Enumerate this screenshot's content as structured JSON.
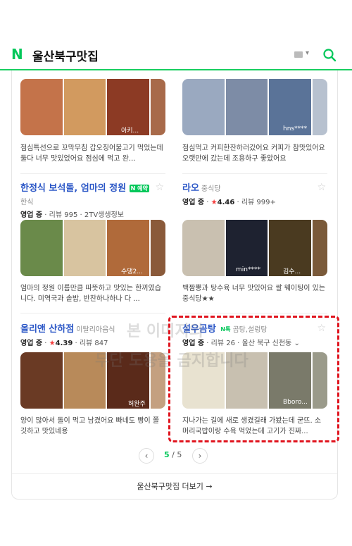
{
  "header": {
    "logo": "N",
    "query": "울산북구맛집"
  },
  "items": [
    {
      "review": "점심특선으로 꼬막무침 갑오징어불고기 먹었는데 둘다 너무 맛있었어요 점심에 먹고 완...",
      "review_bold": "꼬막무침",
      "thumb_user": "아키...",
      "colors": [
        "#c4734a",
        "#d29a5f",
        "#8c3a24",
        "#a86a4a"
      ]
    },
    {
      "review": "점심먹고 커피한잔하러갔어요 커피가 참맛있어요 오랫만에 갔는데 조용하구 좋았어요",
      "review_bold": "커피",
      "thumb_user": "hns****",
      "colors": [
        "#9aa9c0",
        "#7d8ca6",
        "#5a7398",
        "#b7c1cf"
      ]
    },
    {
      "title": "한정식 보석돌, 엄마의 정원",
      "badge": "N 예약",
      "sub": "한식",
      "status": "영업 중",
      "reviews": "리뷰 995",
      "tv": "TV",
      "tv_text": "2TV생생정보",
      "review": "엄마의 정원 이름만큼 따뜻하고 맛있는 한끼였습니다. 미역국과 솥밥, 반찬하나하나 다 ...",
      "review_bold": "미역국과 솥밥",
      "thumb_user": "수댕2...",
      "colors": [
        "#6a8a4a",
        "#d8c4a0",
        "#b06a3a",
        "#8a5a3a"
      ]
    },
    {
      "title": "라오",
      "cat": "중식당",
      "status": "영업 중",
      "rating": "4.46",
      "reviews": "리뷰 999+",
      "review": "백짬뽕과 탕수육 너무 맛있어요 쌀 웨이팅이 있는 중식당★★",
      "review_bold": "",
      "thumb_user": "min****",
      "thumb_user2": "김수...",
      "colors": [
        "#c9c0b0",
        "#1e2230",
        "#4a3a20",
        "#7a5a3a"
      ]
    },
    {
      "title": "올리앤 산하점",
      "cat": "이탈리아음식",
      "status": "영업 중",
      "rating": "4.39",
      "reviews": "리뷰 847",
      "review": "양이 많아서 돌이 먹고 남겼어요 빠네도 빵이 쫄깃하고 맛있네용",
      "review_bold": "빠네",
      "thumb_user": "허완주",
      "colors": [
        "#6a3a24",
        "#b88a5a",
        "#5a2a1a",
        "#c4a080"
      ]
    },
    {
      "title": "설우곰탕",
      "badge": "N톡",
      "cat": "곰탕,설렁탕",
      "status": "영업 중",
      "reviews": "리뷰 26",
      "location": "울산 북구 신천동",
      "review": "지나가는 길에 새로 생겼길래 가봤는데 굳뜨. 소머리국밥이랑 수육 먹었는데 고기가 진짜...",
      "review_bold": "고기",
      "thumb_user": "Bboro...",
      "colors": [
        "#e8e2d0",
        "#c8c0b0",
        "#7a7a6a",
        "#9a9a8a"
      ]
    }
  ],
  "pager": {
    "current": "5",
    "total": "/ 5",
    "prev": "‹",
    "next": "›"
  },
  "more": "울산북구맛집 더보기 →",
  "watermark": {
    "a": "본 이미지의",
    "b": "무단 도용을 금지합니다"
  }
}
